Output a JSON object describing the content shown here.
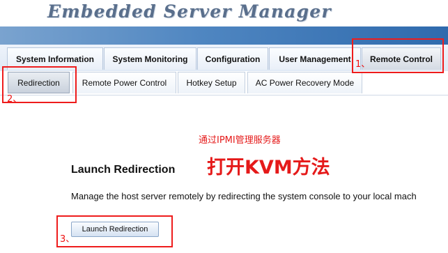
{
  "header": {
    "title": "Embedded Server Manager"
  },
  "main_tabs": [
    {
      "label": "System Information"
    },
    {
      "label": "System Monitoring"
    },
    {
      "label": "Configuration"
    },
    {
      "label": "User Management"
    },
    {
      "label": "Remote Control",
      "active": true
    }
  ],
  "sub_tabs": [
    {
      "label": "Redirection",
      "active": true
    },
    {
      "label": "Remote Power Control"
    },
    {
      "label": "Hotkey Setup"
    },
    {
      "label": "AC Power Recovery Mode"
    }
  ],
  "annotations": {
    "step1": "1、",
    "step2": "2、",
    "step3": "3、",
    "note_small": "通过IPMI管理服务器",
    "note_big": "打开KVM方法",
    "color": "#ee1c1c"
  },
  "content": {
    "section_title": "Launch Redirection",
    "description": "Manage the host server remotely by redirecting the system console to your local mach",
    "launch_button": "Launch Redirection"
  }
}
